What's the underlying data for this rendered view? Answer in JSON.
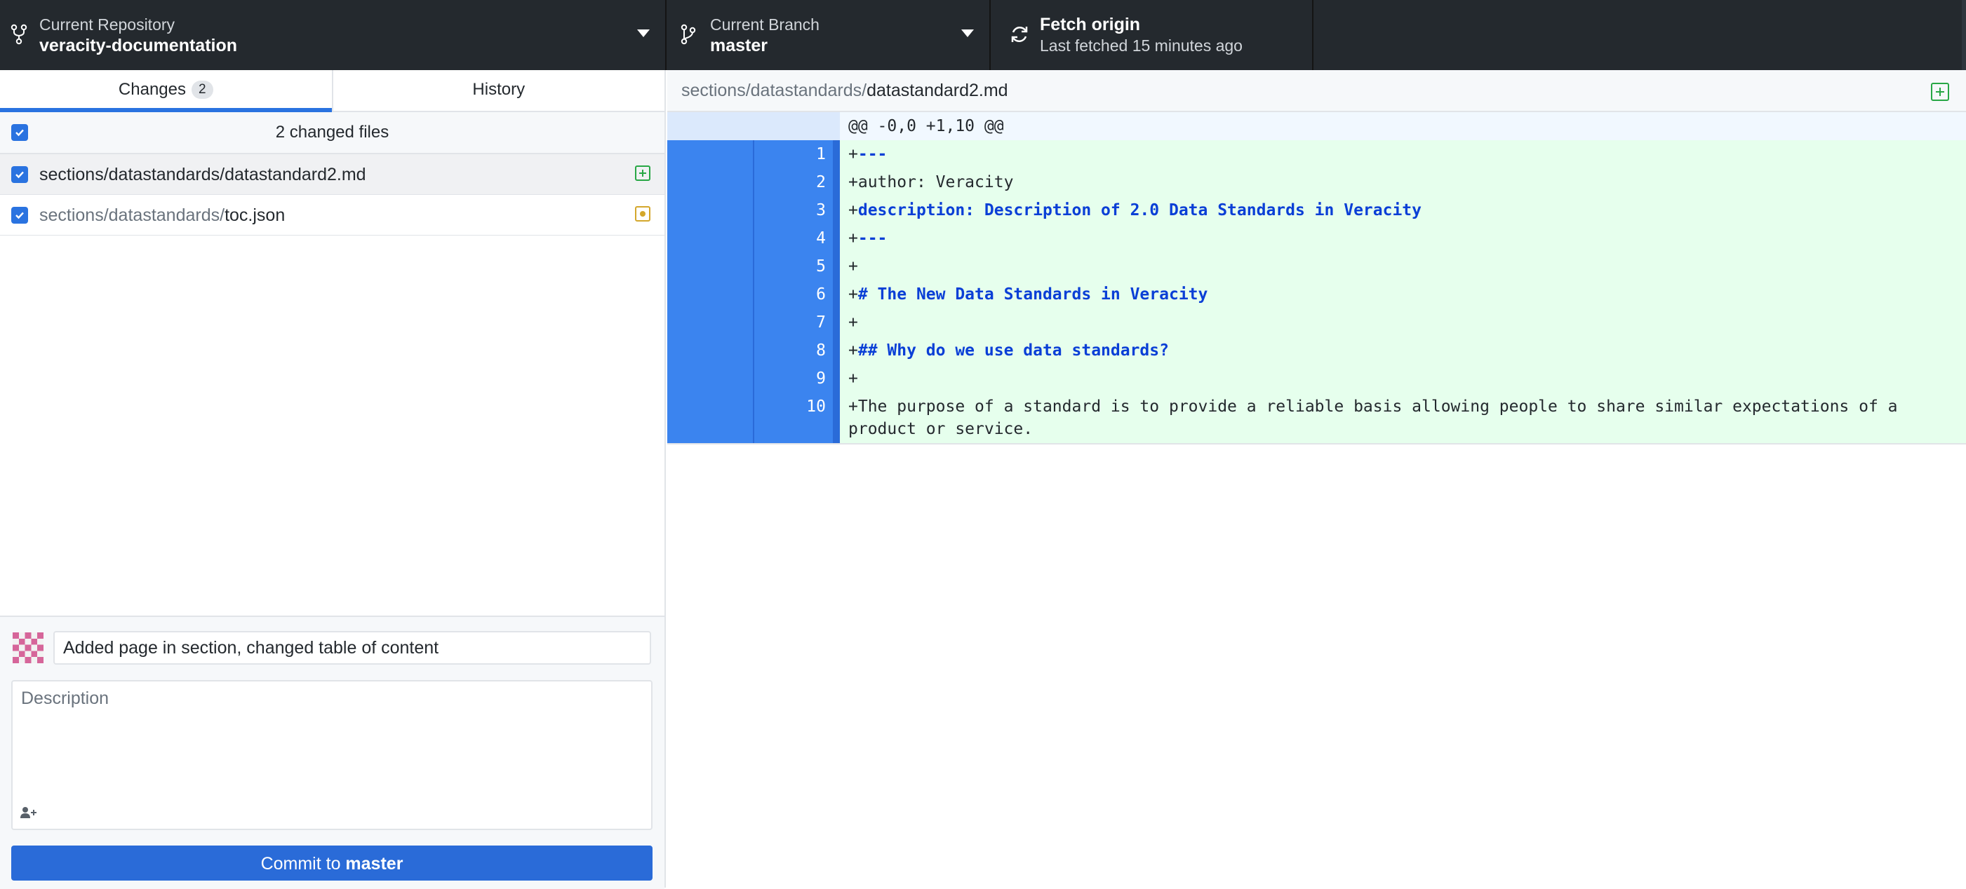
{
  "toolbar": {
    "repository": {
      "label": "Current Repository",
      "value": "veracity-documentation"
    },
    "branch": {
      "label": "Current Branch",
      "value": "master"
    },
    "fetch": {
      "label": "Fetch origin",
      "value": "Last fetched 15 minutes ago"
    }
  },
  "sidebar": {
    "tabs": [
      {
        "label": "Changes",
        "count": "2"
      },
      {
        "label": "History"
      }
    ],
    "files_header": "2 changed files",
    "files": [
      {
        "dir": "sections/datastandards/",
        "name": "datastandard2.md",
        "status": "added"
      },
      {
        "dir": "sections/datastandards/",
        "name": "toc.json",
        "status": "modified"
      }
    ]
  },
  "commit": {
    "summary_value": "Added page in section, changed table of content",
    "description_placeholder": "Description",
    "button_prefix": "Commit to",
    "button_branch": "master"
  },
  "diff": {
    "path_dir": "sections/datastandards/",
    "path_file": "datastandard2.md",
    "hunk_header": "@@ -0,0 +1,10 @@",
    "lines": [
      {
        "num": "1",
        "prefix": "+",
        "text": "---",
        "style": "kw"
      },
      {
        "num": "2",
        "prefix": "+",
        "text": "author: Veracity",
        "style": "plain"
      },
      {
        "num": "3",
        "prefix": "+",
        "text": "description: Description of 2.0 Data Standards in Veracity",
        "style": "kw"
      },
      {
        "num": "4",
        "prefix": "+",
        "text": "---",
        "style": "kw"
      },
      {
        "num": "5",
        "prefix": "+",
        "text": "",
        "style": "plain"
      },
      {
        "num": "6",
        "prefix": "+",
        "text": "# The New Data Standards in Veracity",
        "style": "kw"
      },
      {
        "num": "7",
        "prefix": "+",
        "text": "",
        "style": "plain"
      },
      {
        "num": "8",
        "prefix": "+",
        "text": "## Why do we use data standards?",
        "style": "kw"
      },
      {
        "num": "9",
        "prefix": "+",
        "text": "",
        "style": "plain"
      },
      {
        "num": "10",
        "prefix": "+",
        "text": "The purpose of a standard is to provide a reliable basis allowing people to share similar expectations of a product or service.",
        "style": "plain"
      }
    ]
  },
  "colors": {
    "toolbar_bg": "#24292e",
    "accent_blue": "#2a73e0",
    "added_green": "#28a745",
    "modified_yellow": "#d4a72c",
    "diff_added_bg": "#e6ffed"
  }
}
